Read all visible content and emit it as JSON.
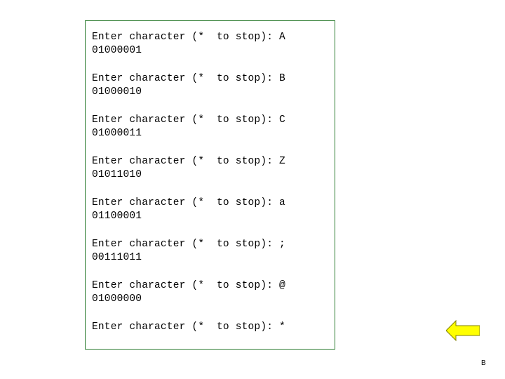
{
  "slide": {
    "page_marker": "B",
    "arrow": {
      "name": "left-arrow-shape",
      "fill": "#ffff00",
      "stroke": "#7f7f00"
    },
    "console": {
      "border_color": "#2e7d32",
      "background": "#ffffff",
      "entries": [
        {
          "prompt": "Enter character (*  to stop): A",
          "output": "01000001"
        },
        {
          "prompt": "Enter character (*  to stop): B",
          "output": "01000010"
        },
        {
          "prompt": "Enter character (*  to stop): C",
          "output": "01000011"
        },
        {
          "prompt": "Enter character (*  to stop): Z",
          "output": "01011010"
        },
        {
          "prompt": "Enter character (*  to stop): a",
          "output": "01100001"
        },
        {
          "prompt": "Enter character (*  to stop): ;",
          "output": "00111011"
        },
        {
          "prompt": "Enter character (*  to stop): @",
          "output": "01000000"
        },
        {
          "prompt": "Enter character (*  to stop): *",
          "output": ""
        }
      ]
    }
  }
}
